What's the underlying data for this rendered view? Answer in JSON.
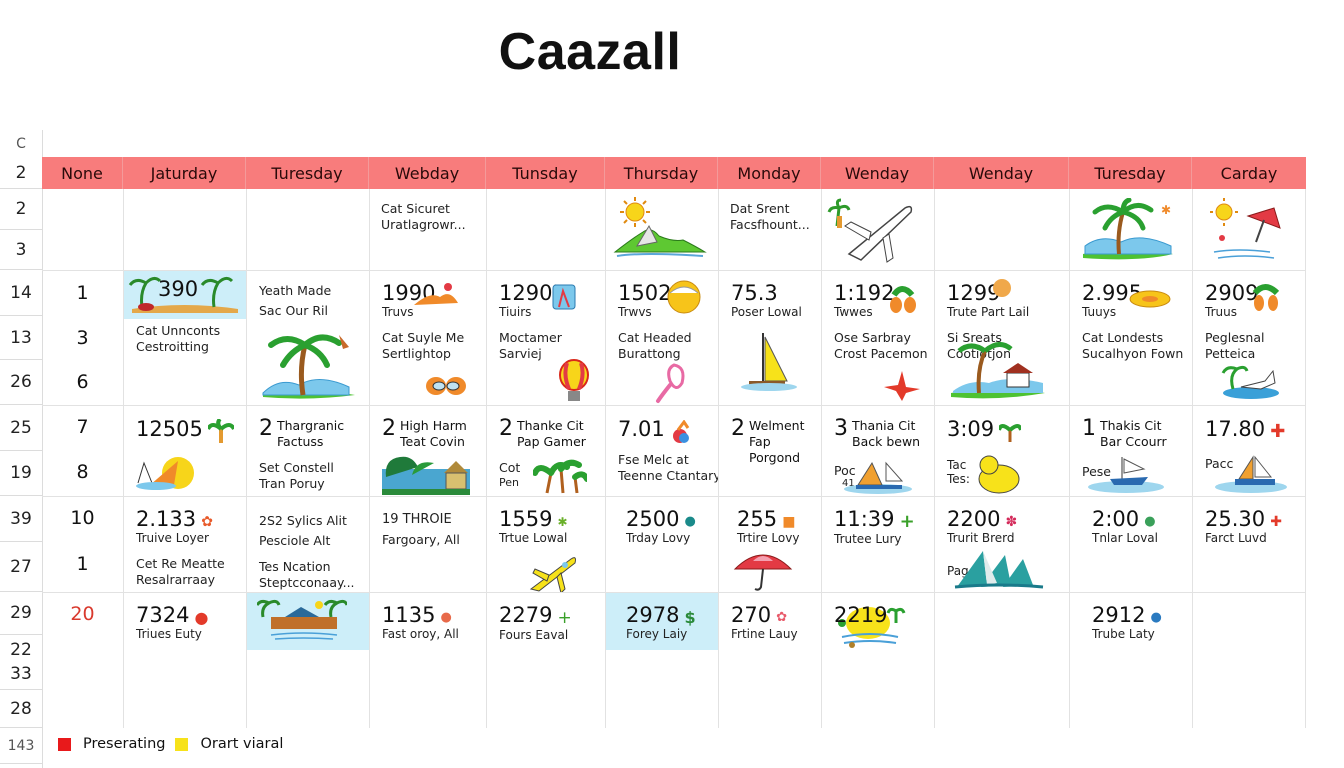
{
  "title": "Caazall",
  "corner_label": "C",
  "row_labels": [
    "2",
    "2",
    "3",
    "14",
    "13",
    "26",
    "25",
    "19",
    "39",
    "27",
    "29",
    "22",
    "33",
    "28",
    "143"
  ],
  "columns": [
    "None",
    "Jaturday",
    "Turesday",
    "Webday",
    "Tunsday",
    "Thursday",
    "Monday",
    "Wenday",
    "Wenday",
    "Turesday",
    "Carday"
  ],
  "row_numbers": [
    "1",
    "3",
    "6",
    "7",
    "8",
    "10",
    "1",
    "20"
  ],
  "colors": {
    "header": "#f87c7c",
    "highlight": "#cdeef9",
    "legend_red": "#e8191b",
    "legend_yellow": "#f7e21a",
    "accent_red": "#d93a2e"
  },
  "cells": {
    "r0_webday": {
      "line1": "Cat Sicuret",
      "line2": "Uratlagrowr..."
    },
    "r0_monday": {
      "line1": "Dat Srent",
      "line2": "Facsfhount..."
    },
    "r1_jaturday": {
      "big": "390",
      "note1": "Cat Unnconts",
      "note2": "Cestroitting"
    },
    "r1_turesday": {
      "line1": "Yeath Made",
      "line2": "Sac Our Ril"
    },
    "r1_webday": {
      "big": "1990",
      "sub": "Truvs",
      "note1": "Cat Suyle Me",
      "note2": "Sertlightop"
    },
    "r1_tunsday": {
      "big": "12905",
      "sub": "Tiuirs",
      "note1": "Moctamer",
      "note2": "Sarviej"
    },
    "r1_thursday": {
      "big": "1502",
      "sub": "Trwvs",
      "note1": "Cat Headed",
      "note2": "Burattong"
    },
    "r1_monday": {
      "big": "75.3",
      "sub": "Poser Lowal"
    },
    "r1_wenday1": {
      "big": "1:192",
      "sub": "Twwes",
      "note1": "Ose Sarbray",
      "note2": "Crost Pacemon"
    },
    "r1_wenday2": {
      "big": "1299",
      "sub": "Trute Part Lail",
      "note1": "Si Sreats",
      "note2": "Cootiotjon"
    },
    "r1_turesday2": {
      "big": "2.995",
      "sub": "Tuuys",
      "note1": "Cat Londests",
      "note2": "Sucalhyon Fown"
    },
    "r1_carday": {
      "big": "2909",
      "sub": "Truus",
      "note1": "Peglesnal",
      "note2": "Petteica"
    },
    "r2_jaturday": {
      "big": "12505"
    },
    "r2_turesday": {
      "num": "2",
      "line1": "Thargranic",
      "line2": "Factuss",
      "note1": "Set Constell",
      "note2": "Tran Poruy"
    },
    "r2_webday": {
      "num": "2",
      "line1": "High Harm",
      "line2": "Teat Covin"
    },
    "r2_tunsday": {
      "num": "2",
      "line1": "Thanke Cit",
      "line2": "Pap Gamer",
      "note1": "Cot",
      "note2": "Pen"
    },
    "r2_thursday": {
      "big": "7.01",
      "note1": "Fse Melc at",
      "note2": "Teenne Ctantary"
    },
    "r2_monday": {
      "num": "2",
      "line1": "Welment",
      "line2": "Fap Porgond"
    },
    "r2_wenday1": {
      "num": "3",
      "line1": "Thania Cit",
      "line2": "Back bewn",
      "note1": "Poc",
      "note2": "41"
    },
    "r2_wenday2": {
      "big": "3:09",
      "note1": "Tac",
      "note2": "Tes:"
    },
    "r2_turesday2": {
      "num": "1",
      "line1": "Thakis Cit",
      "line2": "Bar Ccourr",
      "note1": "Pese"
    },
    "r2_carday": {
      "big": "17.80",
      "note1": "Pacc"
    },
    "r3_jaturday": {
      "big": "2.133",
      "sub": "Truive Loyer",
      "note1": "Cet Re Meatte",
      "note2": "Resalrarraay"
    },
    "r3_turesday": {
      "line1": "2S2 Sylics Alit",
      "line2": "Pesciole Alt",
      "note1": "Tes Ncation",
      "note2": "Steptcconaay..."
    },
    "r3_webday": {
      "line1": "19 THROIE",
      "line2": "Fargoary, All"
    },
    "r3_tunsday": {
      "big": "1559",
      "sub": "Trtue Lowal"
    },
    "r3_thursday": {
      "big": "2500",
      "sub": "Trday Lovy"
    },
    "r3_monday": {
      "big": "255",
      "sub": "Trtire Lovy"
    },
    "r3_wenday1": {
      "big": "11:39",
      "sub": "Trutee Lury"
    },
    "r3_wenday2": {
      "big": "2200",
      "sub": "Trurit Brerd",
      "note1": "Pag"
    },
    "r3_turesday2": {
      "big": "2:00",
      "sub": "Tnlar Loval"
    },
    "r3_carday": {
      "big": "25.30",
      "sub": "Farct Luvd"
    },
    "r4_jaturday": {
      "big": "7324",
      "sub": "Triues Euty"
    },
    "r4_webday": {
      "big": "1135",
      "sub": "Fast oroy, All"
    },
    "r4_tunsday": {
      "big": "2279",
      "sub": "Fours Eaval"
    },
    "r4_thursday": {
      "big": "2978",
      "sub": "Forey Laiy"
    },
    "r4_monday": {
      "big": "270",
      "sub": "Frtine Lauy"
    },
    "r4_wenday1": {
      "big": "2219"
    },
    "r4_turesday2": {
      "big": "2912",
      "sub": "Trube Laty"
    }
  },
  "legend": [
    {
      "label": "Preserating",
      "color": "#e8191b"
    },
    {
      "label": "Orart viaral",
      "color": "#f7e21a"
    }
  ]
}
